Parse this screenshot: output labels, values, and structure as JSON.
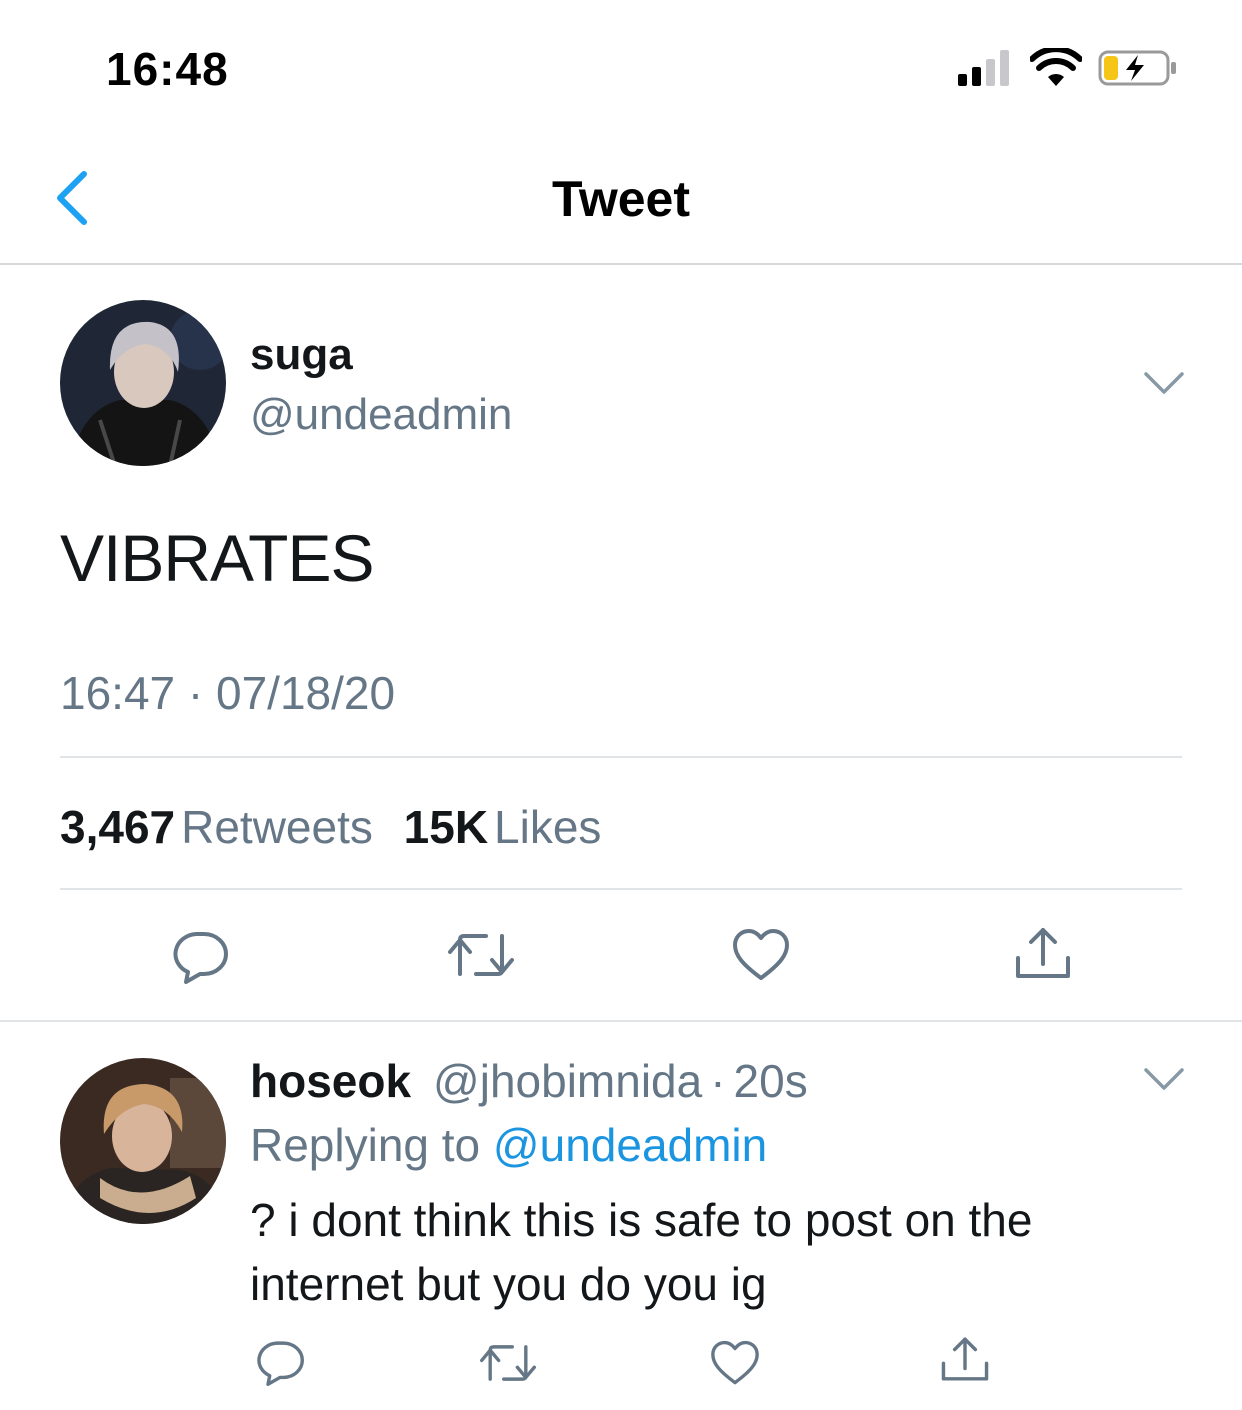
{
  "status_bar": {
    "time": "16:48",
    "signal_icon": "signal-bars-icon",
    "wifi_icon": "wifi-icon",
    "battery_icon": "battery-charging-icon",
    "battery_color": "#f5c518"
  },
  "nav": {
    "title": "Tweet",
    "back_icon": "chevron-left-icon"
  },
  "tweet": {
    "display_name": "suga",
    "handle": "@undeadmin",
    "text": "VIBRATES",
    "timestamp": "16:47 · 07/18/20",
    "retweet_count": "3,467",
    "retweet_label": "Retweets",
    "like_count": "15K",
    "like_label": "Likes",
    "actions": [
      "reply-icon",
      "retweet-icon",
      "like-icon",
      "share-icon"
    ]
  },
  "reply": {
    "display_name": "hoseok",
    "handle": "@jhobimnida",
    "separator": "·",
    "age": "20s",
    "replying_prefix": "Replying to",
    "replying_to": "@undeadmin",
    "text": "? i dont think this is safe to post on the internet but you do you ig",
    "actions": [
      "reply-icon",
      "retweet-icon",
      "like-icon",
      "share-icon"
    ]
  },
  "colors": {
    "accent": "#1da1f2",
    "link": "#1b95e0",
    "secondary_text": "#657786",
    "icon": "#657786",
    "divider": "#e1e4e6"
  }
}
